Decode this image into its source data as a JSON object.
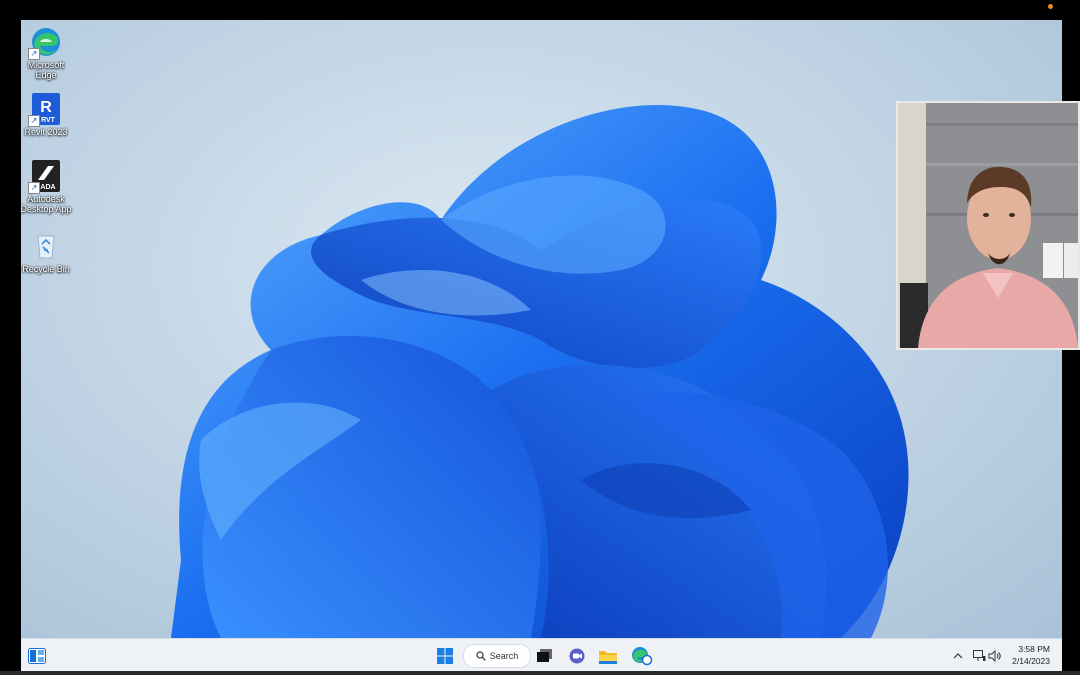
{
  "desktop_icons": [
    {
      "name": "edge",
      "label": "Microsoft Edge"
    },
    {
      "name": "revit",
      "label": "Revit 2023",
      "badge": "RVT",
      "letter": "R"
    },
    {
      "name": "ada",
      "label": "Autodesk Desktop App",
      "badge": "ADA"
    },
    {
      "name": "recycle",
      "label": "Recycle Bin"
    }
  ],
  "taskbar": {
    "search_label": "Search",
    "clock_time": "3:58 PM",
    "clock_date": "2/14/2023"
  },
  "colors": {
    "accent": "#1a5fe0",
    "taskbar_bg": "#eef2f7",
    "rec_dot": "#f08a24"
  }
}
